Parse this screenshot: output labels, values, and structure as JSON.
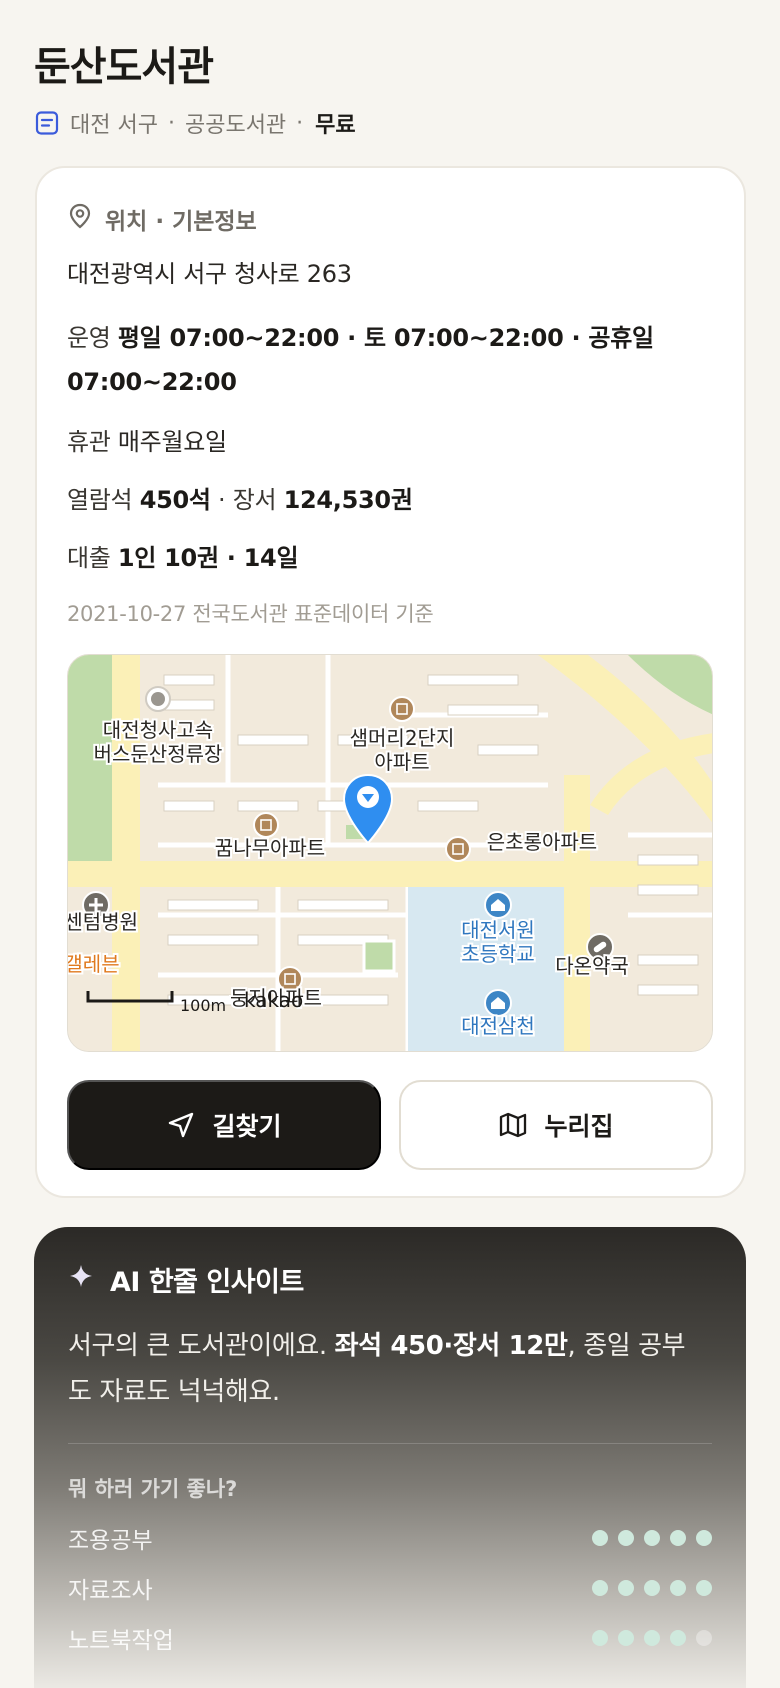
{
  "header": {
    "title": "둔산도서관",
    "region": "대전 서구",
    "sep1": "·",
    "type": "공공도서관",
    "sep2": "·",
    "fee": "무료"
  },
  "info": {
    "section_title": "위치 · 기본정보",
    "address": "대전광역시 서구 청사로 263",
    "hours_label": "운영",
    "hours_value": "평일 07:00~22:00 · 토 07:00~22:00 · 공휴일 07:00~22:00",
    "closed_label": "휴관",
    "closed_value": "매주월요일",
    "seats_label": "열람석",
    "seats_value": "450석",
    "books_sep": "·",
    "books_label": "장서",
    "books_value": "124,530권",
    "loan_label": "대출",
    "loan_value": "1인 10권 · 14일",
    "data_date": "2021-10-27 전국도서관 표준데이터 기준"
  },
  "map": {
    "labels": {
      "bus": "대전청사고속",
      "bus2": "버스둔산정류장",
      "apt1": "샘머리2단지",
      "apt1b": "아파트",
      "apt2": "꿈나무아파트",
      "apt3": "은초롱아파트",
      "hospital": "선센텀병원",
      "school": "대전서원",
      "school2": "초등학교",
      "pharmacy": "다온약국",
      "galleria": "갤레븐",
      "apt4": "둥지아파트",
      "school3": "대전삼천",
      "scale": "100m",
      "brand": "kakao"
    }
  },
  "actions": {
    "route_label": "길찾기",
    "site_label": "누리집"
  },
  "ai": {
    "title": "AI 한줄 인사이트",
    "text_pre": "서구의 큰 도서관이에요. ",
    "text_bold": "좌석 450·장서 12만",
    "text_post": ", 종일 공부도 자료도 넉넉해요.",
    "question": "뭐 하러 가기 좋나?",
    "ratings": [
      {
        "label": "조용공부",
        "score": 5,
        "max": 5
      },
      {
        "label": "자료조사",
        "score": 5,
        "max": 5
      },
      {
        "label": "노트북작업",
        "score": 4,
        "max": 5
      }
    ]
  },
  "colors": {
    "accent_dark": "#1c1a17",
    "map_pin": "#2f8ef0",
    "dot_on": "#cfe9dd",
    "subtitle_icon": "#3b5bdb"
  }
}
